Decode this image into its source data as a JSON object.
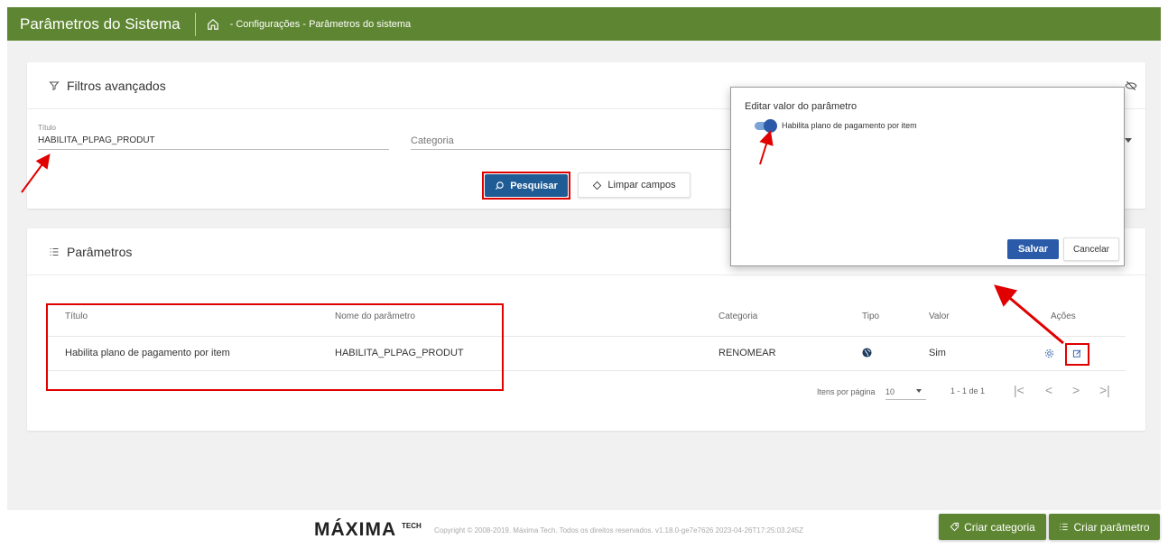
{
  "header": {
    "app_title": "Parâmetros do Sistema",
    "breadcrumb": "- Configurações - Parâmetros do sistema"
  },
  "filters": {
    "title": "Filtros avançados",
    "titulo_label": "Título",
    "titulo_value": "HABILITA_PLPAG_PRODUT",
    "categoria_placeholder": "Categoria",
    "search_label": "Pesquisar",
    "clear_label": "Limpar campos"
  },
  "params": {
    "title": "Parâmetros",
    "columns": [
      "Título",
      "Nome do parâmetro",
      "Categoria",
      "Tipo",
      "Valor",
      "Ações"
    ],
    "rows": [
      {
        "titulo": "Habilita plano de pagamento por item",
        "nome": "HABILITA_PLPAG_PRODUT",
        "categoria": "RENOMEAR",
        "tipo_icon": "globe-icon",
        "valor": "Sim"
      }
    ],
    "paginator": {
      "items_per_page_label": "Itens por página",
      "page_size": "10",
      "range": "1 - 1 de 1"
    }
  },
  "modal": {
    "title": "Editar valor do parâmetro",
    "toggle_label": "Habilita plano de pagamento por item",
    "toggle_on": true,
    "save_label": "Salvar",
    "cancel_label": "Cancelar"
  },
  "footer": {
    "brand": "MÁXIMA",
    "brand_suffix": "TECH",
    "copyright": "Copyright © 2008-2019. Máxima Tech. Todos os direitos reservados. v1.18.0-ge7e7626 2023-04-26T17:25:03.245Z",
    "create_category_label": "Criar categoria",
    "create_param_label": "Criar parâmetro"
  },
  "colors": {
    "header_green": "#5e8632",
    "primary_blue": "#1f5c96",
    "annotation_red": "#e00000"
  }
}
